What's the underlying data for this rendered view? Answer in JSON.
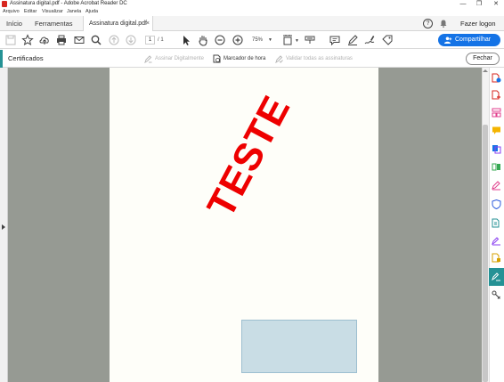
{
  "window": {
    "title": "Assinatura digital.pdf - Adobe Acrobat Reader DC",
    "controls": [
      "—",
      "❐",
      "✕"
    ]
  },
  "menu": [
    "Arquivo",
    "Editar",
    "Visualizar",
    "Janela",
    "Ajuda"
  ],
  "tabs": {
    "home": "Início",
    "tools": "Ferramentas",
    "document": "Assinatura digital.pdf",
    "close_symbol": "×"
  },
  "header": {
    "help_symbol": "?",
    "login": "Fazer logon"
  },
  "toolbar": {
    "page_current": "1",
    "page_total": "/ 1",
    "zoom": "75%",
    "share_label": "Compartilhar"
  },
  "certificates": {
    "title": "Certificados",
    "sign_digitally": "Assinar Digitalmente",
    "timestamp": "Marcador de hora",
    "validate_all": "Validar todas as assinaturas",
    "close": "Fechar"
  },
  "document": {
    "stamp_text": "TESTE",
    "stamp_color": "#ee0000"
  },
  "colors": {
    "accent_teal": "#259295",
    "share_blue": "#1473e6",
    "canvas_gray": "#969a93"
  }
}
